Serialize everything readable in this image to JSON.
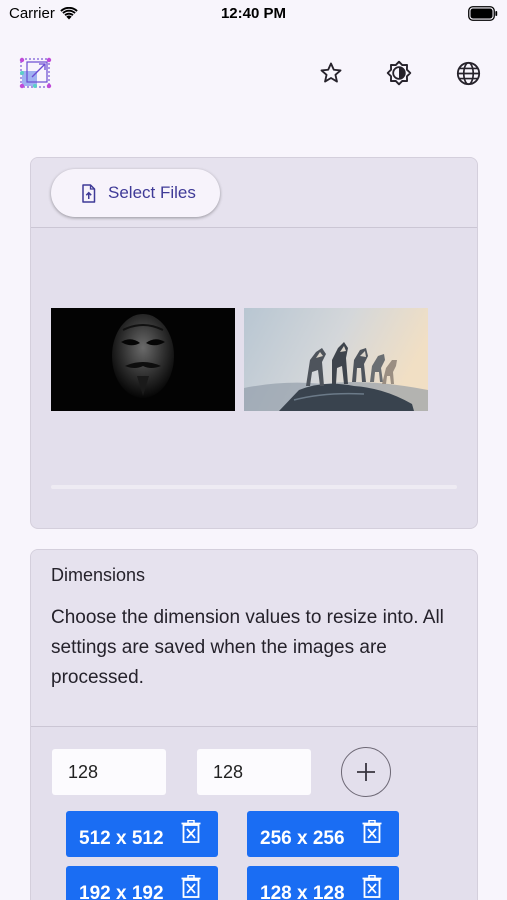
{
  "status_bar": {
    "carrier": "Carrier",
    "time": "12:40 PM"
  },
  "toolbar": {
    "logo_icon": "image-resize-logo-icon",
    "actions": [
      {
        "icon": "star-icon"
      },
      {
        "icon": "brightness-icon"
      },
      {
        "icon": "globe-icon"
      }
    ]
  },
  "files": {
    "select_label": "Select Files",
    "select_icon": "file-upload-icon",
    "thumbnails": [
      {
        "subject": "mask-image"
      },
      {
        "subject": "wolves-image"
      }
    ]
  },
  "dimensions": {
    "title": "Dimensions",
    "description": "Choose the dimension values to resize into. All settings are saved when the images are processed.",
    "width_value": "128",
    "height_value": "128",
    "add_icon": "plus-icon",
    "presets": [
      {
        "label": "512 x 512"
      },
      {
        "label": "256 x 256"
      },
      {
        "label": "192 x 192"
      },
      {
        "label": "128 x 128"
      }
    ]
  },
  "colors": {
    "accent": "#1a6df3",
    "button_text": "#3f3a97",
    "card": "#e3dfec",
    "background": "#f8f5fc"
  }
}
